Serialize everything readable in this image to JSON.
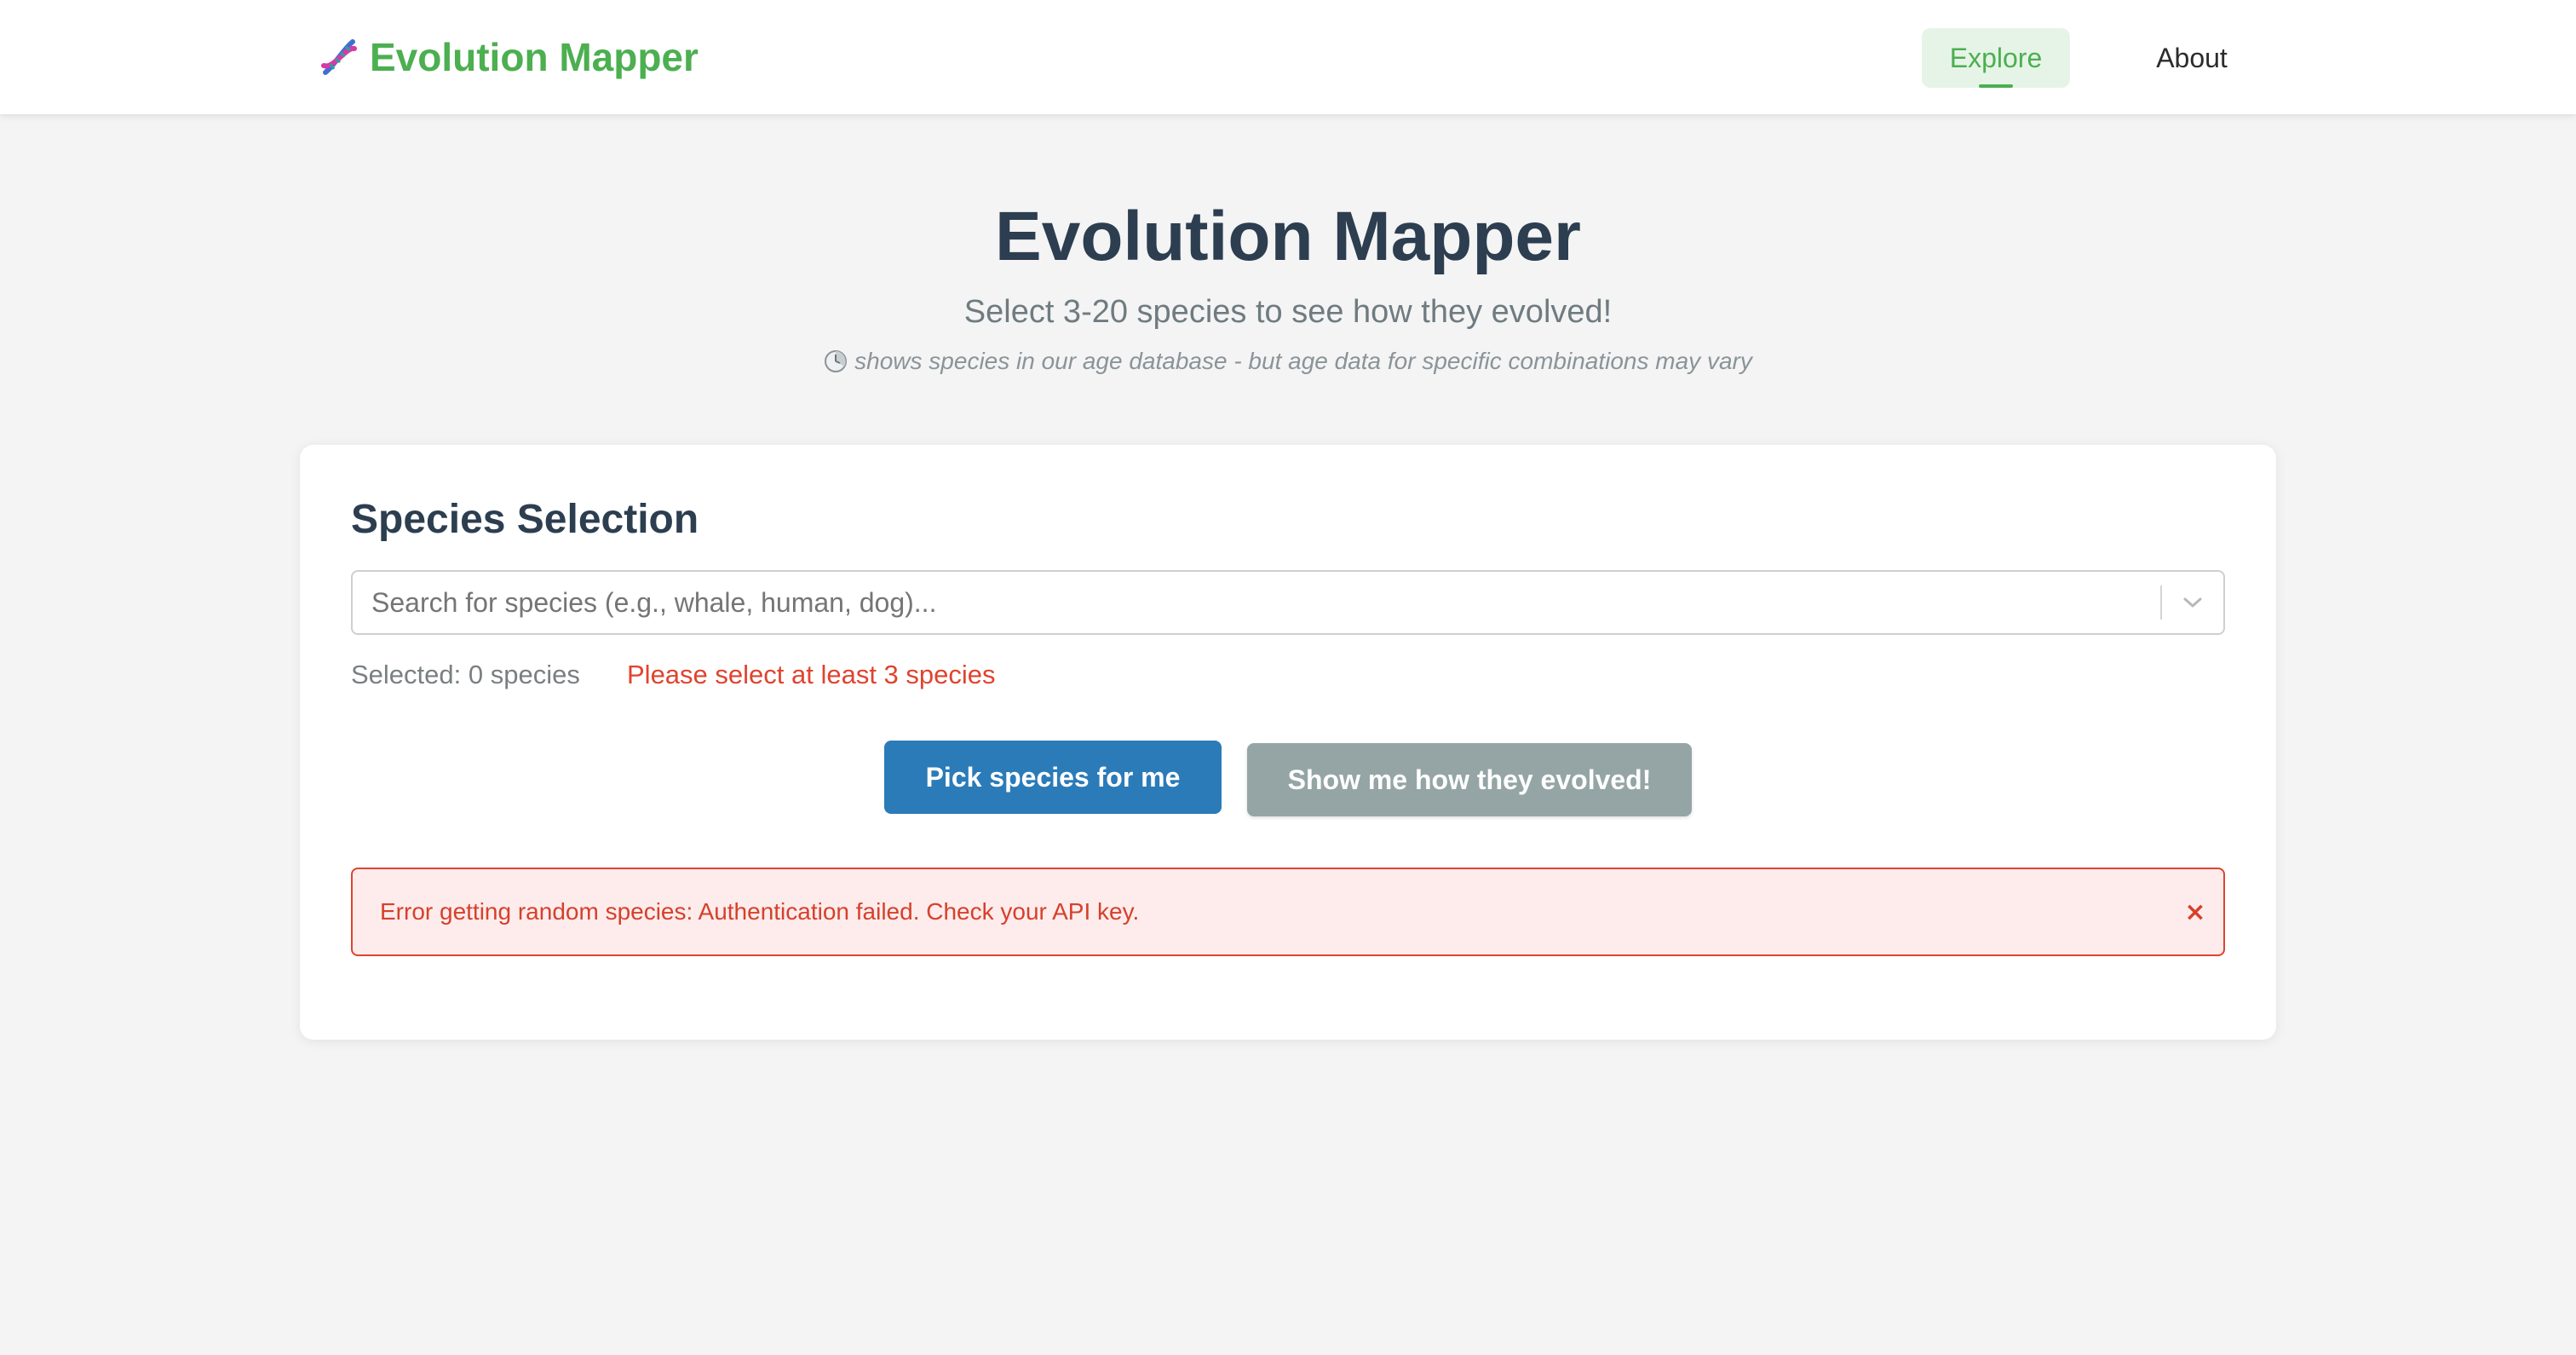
{
  "header": {
    "brand_label": "Evolution Mapper",
    "brand_icon": "dna-icon",
    "nav": [
      {
        "label": "Explore",
        "active": true
      },
      {
        "label": "About",
        "active": false
      }
    ]
  },
  "hero": {
    "title": "Evolution Mapper",
    "subtitle": "Select 3-20 species to see how they evolved!",
    "note": "shows species in our age database - but age data for specific combinations may vary",
    "note_icon": "clock-icon"
  },
  "selection": {
    "title": "Species Selection",
    "search_placeholder": "Search for species (e.g., whale, human, dog)...",
    "search_value": "",
    "selected_text": "Selected: 0 species",
    "warning_text": "Please select at least 3 species"
  },
  "actions": {
    "pick_label": "Pick species for me",
    "evolve_label": "Show me how they evolved!"
  },
  "error": {
    "message": "Error getting random species: Authentication failed. Check your API key.",
    "close_label": "×"
  },
  "colors": {
    "brand_green": "#4caf50",
    "primary_blue": "#2b7bb8",
    "disabled_gray": "#95a5a6",
    "error_red": "#e0432f",
    "heading_dark": "#2c3e50"
  }
}
